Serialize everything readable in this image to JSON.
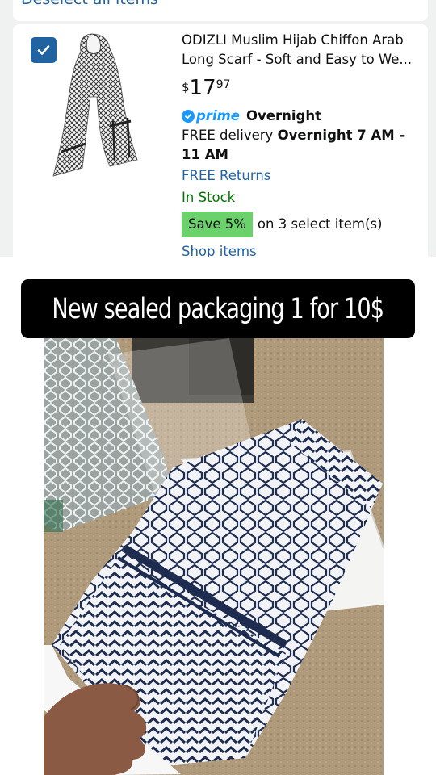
{
  "header": {
    "deselect_label": "Deselect all items"
  },
  "product": {
    "checked": true,
    "title": "ODIZLI Muslim Hijab Chiffon Arab Long Scarf - Soft and Easy to We...",
    "price_symbol": "$",
    "price_whole": "17",
    "price_fraction": "97",
    "prime_label": "prime",
    "prime_speed": "Overnight",
    "delivery_prefix": "FREE delivery ",
    "delivery_time_line1": "Overnight 7 AM -",
    "delivery_time_line2": "11 AM",
    "returns_label": "FREE Returns",
    "stock_status": "In Stock",
    "save_badge": "Save 5%",
    "save_suffix": "on 3 select item(s)",
    "shop_items_label": "Shop items"
  },
  "caption": {
    "text": "New sealed packaging 1 for 10$"
  },
  "colors": {
    "link_blue": "#2162a1",
    "prime_blue": "#1a98ff",
    "in_stock_green": "#007600",
    "save_badge_green": "#6ad16b",
    "scarf_navy": "#1e2d4f"
  }
}
